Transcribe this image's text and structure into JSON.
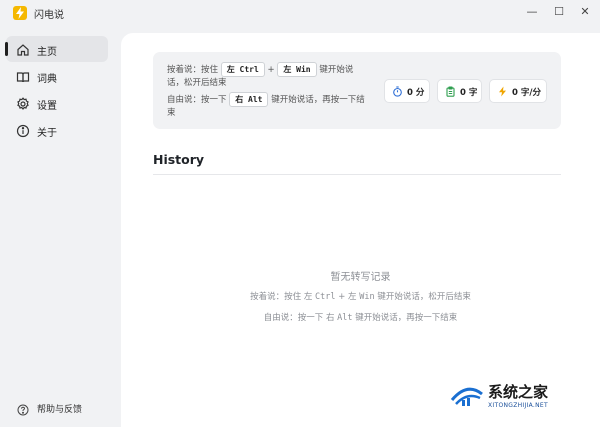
{
  "app": {
    "title": "闪电说"
  },
  "window": {
    "minimize": "—",
    "maximize": "☐",
    "close": "✕"
  },
  "sidebar": {
    "items": [
      {
        "label": "主页",
        "icon": "home-icon",
        "active": true
      },
      {
        "label": "词典",
        "icon": "book-icon",
        "active": false
      },
      {
        "label": "设置",
        "icon": "gear-icon",
        "active": false
      },
      {
        "label": "关于",
        "icon": "info-icon",
        "active": false
      }
    ],
    "help": {
      "label": "帮助与反馈",
      "icon": "help-icon"
    }
  },
  "info_panel": {
    "hold_prefix": "按着说：按住",
    "hold_key1": "左 Ctrl",
    "plus": "+",
    "hold_key2": "左 Win",
    "hold_suffix_1": "键开始说",
    "hold_suffix_2": "话，松开后结束",
    "free_prefix": "自由说：按一下",
    "free_key": "右 Alt",
    "free_suffix_1": "键开始说话，再按一下结",
    "free_suffix_2": "束",
    "stats": [
      {
        "value": "0 分",
        "icon": "stopwatch-icon",
        "color": "#2f6fd6"
      },
      {
        "value": "0 字",
        "icon": "clipboard-icon",
        "color": "#2e9e4f"
      },
      {
        "value": "0 字/分",
        "icon": "lightning-icon",
        "color": "#f0a500"
      }
    ]
  },
  "history": {
    "title": "History",
    "empty_title": "暂无转写记录",
    "hint_hold_a": "按着说：按住 左",
    "hint_hold_b": "Ctrl",
    "hint_hold_c": "+ 左",
    "hint_hold_d": "Win",
    "hint_hold_e": "键开始说话，松开后结束",
    "hint_free_a": "自由说：按一下 右",
    "hint_free_b": "Alt",
    "hint_free_c": "键开始说话，再按一下结束"
  },
  "watermark": {
    "text": "系统之家",
    "sub": "XITONGZHIJIA.NET"
  }
}
